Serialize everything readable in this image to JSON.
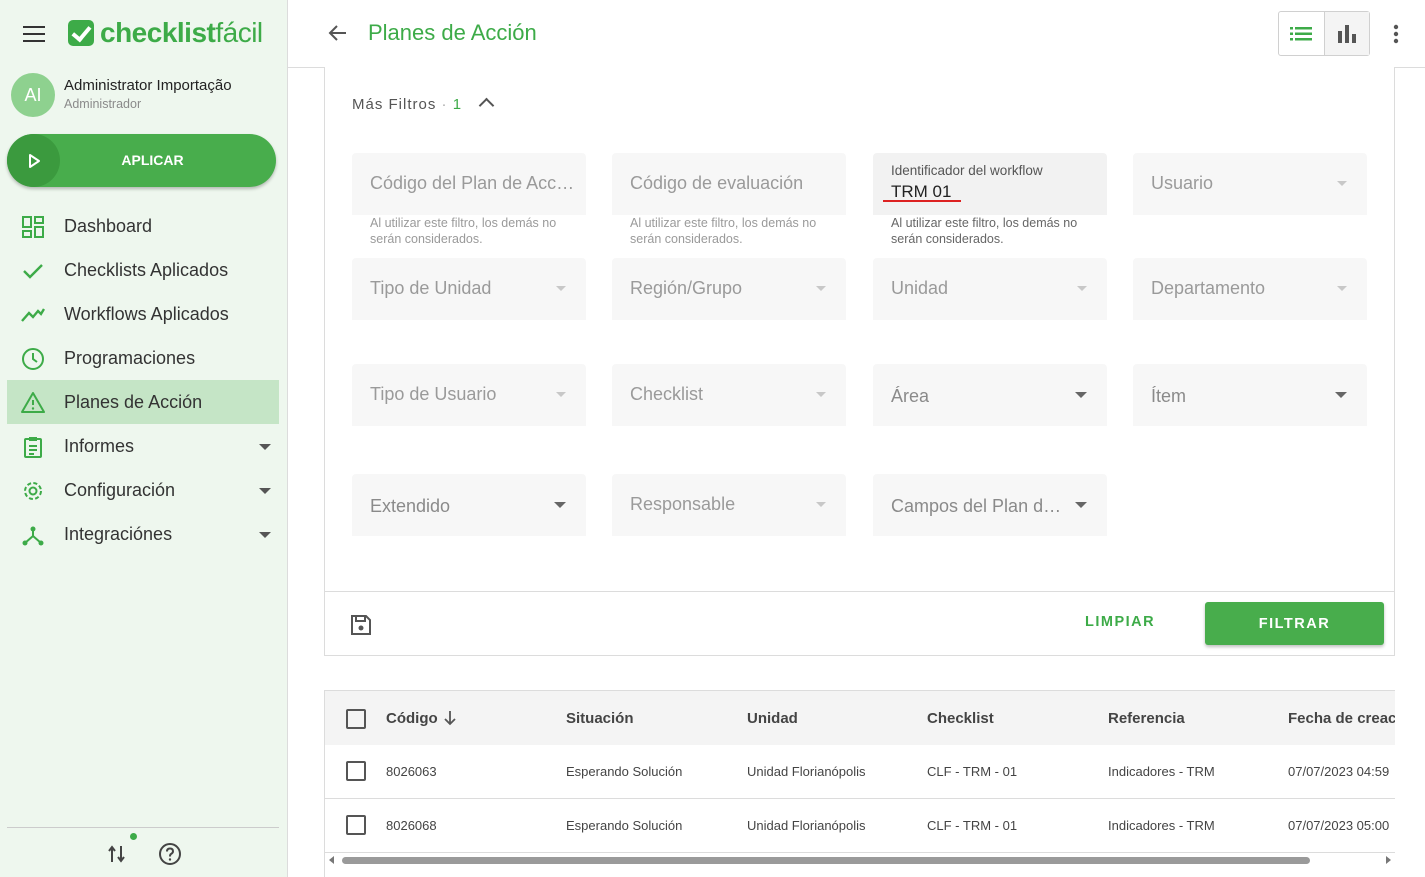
{
  "app": {
    "logo_text_bold": "checklist",
    "logo_text_light": "fácil"
  },
  "user": {
    "initials": "AI",
    "name": "Administrator Importação",
    "role": "Administrador"
  },
  "sidebar": {
    "apply_label": "APLICAR",
    "items": [
      {
        "label": "Dashboard",
        "icon": "dashboard-icon"
      },
      {
        "label": "Checklists Aplicados",
        "icon": "check-icon"
      },
      {
        "label": "Workflows Aplicados",
        "icon": "trending-icon"
      },
      {
        "label": "Programaciones",
        "icon": "clock-icon"
      },
      {
        "label": "Planes de Acción",
        "icon": "warning-icon",
        "active": true
      },
      {
        "label": "Informes",
        "icon": "clipboard-icon",
        "expandable": true
      },
      {
        "label": "Configuración",
        "icon": "gear-icon",
        "expandable": true
      },
      {
        "label": "Integraciónes",
        "icon": "integration-icon",
        "expandable": true
      }
    ]
  },
  "header": {
    "title": "Planes de Acción"
  },
  "filters": {
    "more_filters_label": "Más Filtros",
    "more_filters_sep": "·",
    "more_filters_count": "1",
    "hint_text": "Al utilizar este filtro, los demás no serán considerados.",
    "fields": {
      "codigo_plan": "Código del Plan de Acción",
      "codigo_evaluacion": "Código de evaluación",
      "workflow_label": "Identificador del workflow",
      "workflow_value": "TRM 01",
      "usuario": "Usuario",
      "tipo_unidad": "Tipo de Unidad",
      "region": "Región/Grupo",
      "unidad": "Unidad",
      "departamento": "Departamento",
      "tipo_usuario": "Tipo de Usuario",
      "checklist": "Checklist",
      "area": "Área",
      "item": "Ítem",
      "extendido": "Extendido",
      "responsable": "Responsable",
      "campos": "Campos del Plan de Acción"
    },
    "clear_label": "LIMPIAR",
    "filter_label": "FILTRAR"
  },
  "table": {
    "columns": [
      "Código",
      "Situación",
      "Unidad",
      "Checklist",
      "Referencia",
      "Fecha de creación"
    ],
    "rows": [
      [
        "8026063",
        "Esperando Solución",
        "Unidad Florianópolis",
        "CLF - TRM - 01",
        "Indicadores - TRM",
        "07/07/2023 04:59"
      ],
      [
        "8026068",
        "Esperando Solución",
        "Unidad Florianópolis",
        "CLF - TRM - 01",
        "Indicadores - TRM",
        "07/07/2023 05:00"
      ]
    ]
  },
  "colors": {
    "brand": "#3dab48",
    "active_nav": "#c5e5c6",
    "sidebar_bg": "#eef7ee"
  }
}
